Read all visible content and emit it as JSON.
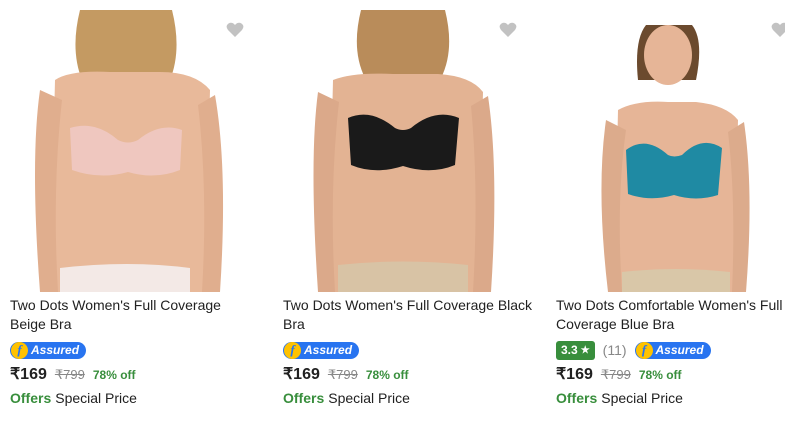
{
  "products": [
    {
      "title": "Two Dots Women's Full Coverage Beige Bra",
      "assured_label": "Assured",
      "price": "₹169",
      "mrp": "₹799",
      "discount": "78% off",
      "offers_label": "Offers",
      "offer_text": "Special Price",
      "bra_color": "#efc7bf",
      "skin_color": "#e8b99a",
      "hair_color": "#c49a62",
      "bottom_color": "#f3e9e6"
    },
    {
      "title": "Two Dots Women's Full Coverage Black Bra",
      "assured_label": "Assured",
      "price": "₹169",
      "mrp": "₹799",
      "discount": "78% off",
      "offers_label": "Offers",
      "offer_text": "Special Price",
      "bra_color": "#1a1a1a",
      "skin_color": "#e3b393",
      "hair_color": "#b98c5a",
      "bottom_color": "#d8c3a5"
    },
    {
      "title": "Two Dots Comfortable Women's Full Coverage Blue Bra",
      "rating": "3.3",
      "rating_count": "(11)",
      "assured_label": "Assured",
      "price": "₹169",
      "mrp": "₹799",
      "discount": "78% off",
      "offers_label": "Offers",
      "offer_text": "Special Price",
      "bra_color": "#1f8aa3",
      "skin_color": "#e6b597",
      "hair_color": "#6b4a2e",
      "bottom_color": "#d9c7a8"
    }
  ]
}
